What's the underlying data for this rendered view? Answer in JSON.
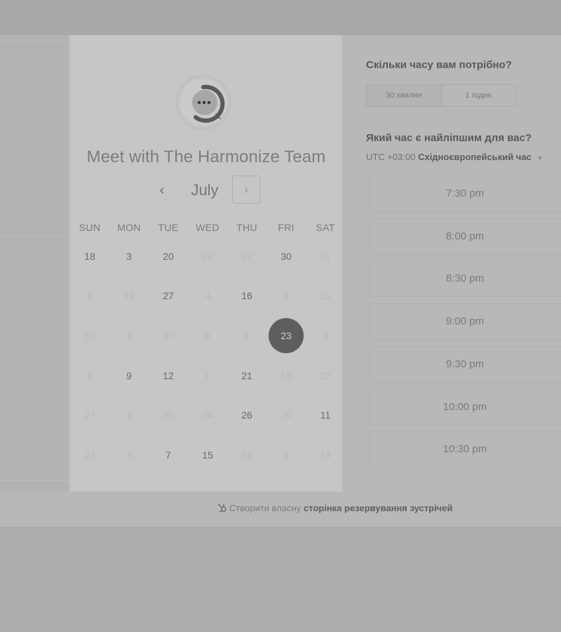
{
  "host": {
    "title": "Meet with The Harmonize Team"
  },
  "calendar": {
    "month": "July",
    "prev_icon": "‹",
    "next_icon": "›",
    "weekdays": [
      "SUN",
      "MON",
      "TUE",
      "WED",
      "THU",
      "FRI",
      "SAT"
    ],
    "rows": [
      [
        {
          "d": "18",
          "s": "available"
        },
        {
          "d": "3",
          "s": "available"
        },
        {
          "d": "20",
          "s": "available"
        },
        {
          "d": "22",
          "s": "disabled"
        },
        {
          "d": "27",
          "s": "disabled"
        },
        {
          "d": "30",
          "s": "available"
        },
        {
          "d": "31",
          "s": "disabled"
        }
      ],
      [
        {
          "d": "4",
          "s": "disabled"
        },
        {
          "d": "19",
          "s": "disabled"
        },
        {
          "d": "27",
          "s": "available"
        },
        {
          "d": "4",
          "s": "disabled"
        },
        {
          "d": "16",
          "s": "available"
        },
        {
          "d": "5",
          "s": "disabled"
        },
        {
          "d": "31",
          "s": "disabled"
        }
      ],
      [
        {
          "d": "30",
          "s": "disabled"
        },
        {
          "d": "2",
          "s": "disabled"
        },
        {
          "d": "30",
          "s": "disabled"
        },
        {
          "d": "6",
          "s": "disabled"
        },
        {
          "d": "4",
          "s": "disabled"
        },
        {
          "d": "23",
          "s": "selected"
        },
        {
          "d": "9",
          "s": "disabled"
        }
      ],
      [
        {
          "d": "9",
          "s": "disabled"
        },
        {
          "d": "9",
          "s": "available"
        },
        {
          "d": "12",
          "s": "available"
        },
        {
          "d": "1",
          "s": "disabled"
        },
        {
          "d": "21",
          "s": "available"
        },
        {
          "d": "16",
          "s": "disabled"
        },
        {
          "d": "27",
          "s": "disabled"
        }
      ],
      [
        {
          "d": "27",
          "s": "disabled"
        },
        {
          "d": "4",
          "s": "disabled"
        },
        {
          "d": "25",
          "s": "disabled"
        },
        {
          "d": "24",
          "s": "disabled"
        },
        {
          "d": "26",
          "s": "available"
        },
        {
          "d": "30",
          "s": "disabled"
        },
        {
          "d": "11",
          "s": "available"
        }
      ],
      [
        {
          "d": "22",
          "s": "disabled"
        },
        {
          "d": "3",
          "s": "disabled"
        },
        {
          "d": "7",
          "s": "available"
        },
        {
          "d": "15",
          "s": "available"
        },
        {
          "d": "16",
          "s": "disabled"
        },
        {
          "d": "3",
          "s": "disabled"
        },
        {
          "d": "13",
          "s": "disabled"
        }
      ]
    ]
  },
  "duration": {
    "question": "Скільки часу вам потрібно?",
    "options": [
      "30 хвилин",
      "1 годин"
    ],
    "selected_index": 0
  },
  "time": {
    "question": "Який час є найліпшим для вас?",
    "tz_offset": "UTC +03:00",
    "tz_name": "Східноєвропейський час",
    "tz_caret": "▼",
    "slots": [
      "7:30 pm",
      "8:00 pm",
      "8:30 pm",
      "9:00 pm",
      "9:30 pm",
      "10:00 pm",
      "10:30 pm"
    ]
  },
  "footer": {
    "prefix": "Створити власну",
    "bold": "сторінка резервування зустрічей"
  },
  "colors": {
    "selected_day": "#5e5e5e",
    "panel": "#c6c6c6",
    "page": "#acacac"
  }
}
